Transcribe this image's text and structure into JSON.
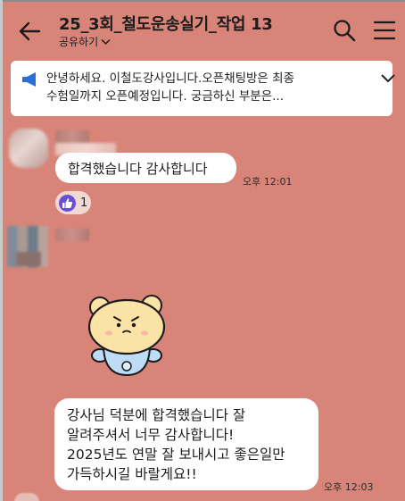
{
  "header": {
    "title": "25_3회_철도운송실기_작업 13",
    "subtitle": "공유하기",
    "back_icon": "back-arrow-icon",
    "search_icon": "search-icon",
    "menu_icon": "hamburger-menu-icon"
  },
  "notice": {
    "icon": "megaphone-icon",
    "line1": "안녕하세요. 이철도강사입니다.오픈채팅방은 최종",
    "line2": "수험일까지 오픈예정입니다. 궁금하신 부분은...",
    "toggle_icon": "chevron-down-icon"
  },
  "messages": [
    {
      "text": "합격했습니다 감사합니다",
      "time": "오후 12:01",
      "reaction": {
        "icon": "thumbs-up-icon",
        "count": "1"
      }
    },
    {
      "sticker": "bear-sticker",
      "lines": [
        "강사님 덕분에 합격했습니다 잘",
        "알려주셔서 너무 감사합니다!",
        "2025년도 연말 잘 보내시고 좋은일만",
        "가득하시길 바랄게요!!"
      ],
      "time": "오후 12:03"
    }
  ],
  "colors": {
    "background": "#d98478",
    "bubble": "#ffffff",
    "notice_accent": "#2a6fd6",
    "reaction_badge": "#6a4fd6"
  }
}
